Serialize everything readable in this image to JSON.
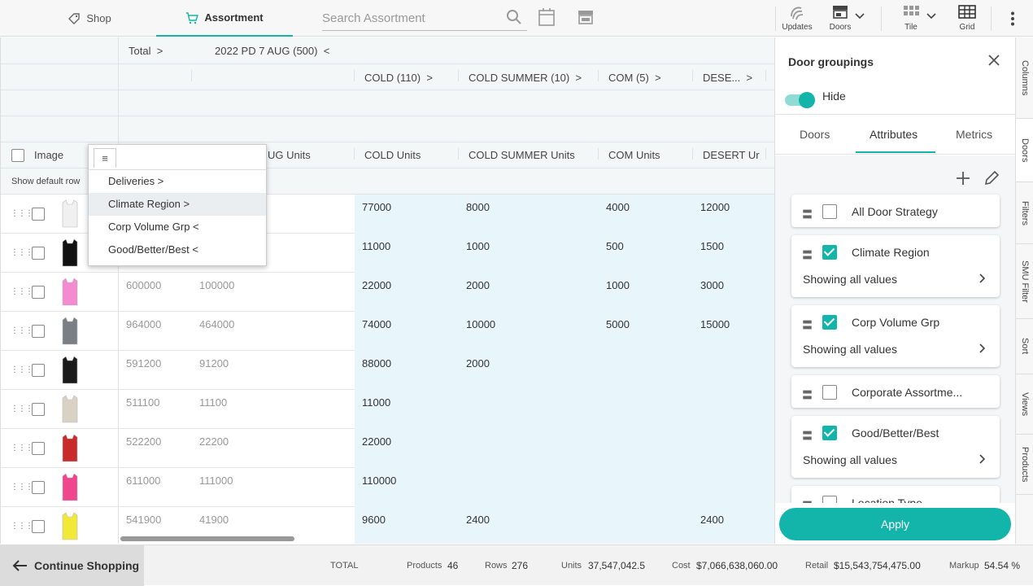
{
  "topbar": {
    "shop_label": "Shop",
    "assortment_label": "Assortment",
    "search_placeholder": "Search Assortment",
    "updates_label": "Updates",
    "doors_label": "Doors",
    "tile_label": "Tile",
    "grid_label": "Grid"
  },
  "grid": {
    "header_row1": {
      "total": "Total",
      "total_chev": ">",
      "period": "2022 PD 7 AUG (500)",
      "period_chev": "<"
    },
    "header_row2": [
      {
        "label": "COLD (110)",
        "chev": ">"
      },
      {
        "label": "COLD SUMMER (10)",
        "chev": ">"
      },
      {
        "label": "COM (5)",
        "chev": ">"
      },
      {
        "label": "DESE...",
        "chev": ">"
      }
    ],
    "columns": {
      "image": "Image",
      "aug_units": "UG Units",
      "cold": "COLD Units",
      "cold_summer": "COLD SUMMER Units",
      "com": "COM Units",
      "desert": "DESERT Ur"
    },
    "show_default_row": "Show default row",
    "rows": [
      {
        "c1": "",
        "c2": "",
        "cold": "77000",
        "cs": "8000",
        "com": "4000",
        "des": "12000",
        "img": "#f0f0f0"
      },
      {
        "c1": "",
        "c2": "",
        "cold": "11000",
        "cs": "1000",
        "com": "500",
        "des": "1500",
        "img": "#111111"
      },
      {
        "c1": "600000",
        "c2": "100000",
        "cold": "22000",
        "cs": "2000",
        "com": "1000",
        "des": "3000",
        "img": "#f48ad0"
      },
      {
        "c1": "964000",
        "c2": "464000",
        "cold": "74000",
        "cs": "10000",
        "com": "5000",
        "des": "15000",
        "img": "#7a7f86"
      },
      {
        "c1": "591200",
        "c2": "91200",
        "cold": "88000",
        "cs": "2000",
        "com": "",
        "des": "",
        "img": "#1a1a1a"
      },
      {
        "c1": "511100",
        "c2": "11100",
        "cold": "11000",
        "cs": "",
        "com": "",
        "des": "",
        "img": "#d9d2c4"
      },
      {
        "c1": "522200",
        "c2": "22200",
        "cold": "22000",
        "cs": "",
        "com": "",
        "des": "",
        "img": "#c92a2a"
      },
      {
        "c1": "611000",
        "c2": "111000",
        "cold": "110000",
        "cs": "",
        "com": "",
        "des": "",
        "img": "#f0468e"
      },
      {
        "c1": "541900",
        "c2": "41900",
        "cold": "9600",
        "cs": "2400",
        "com": "",
        "des": "2400",
        "img": "#f2e838"
      }
    ]
  },
  "popup": {
    "menu_icon": "≡",
    "items": [
      "Deliveries >",
      "Climate Region >",
      "Corp Volume Grp <",
      "Good/Better/Best <"
    ]
  },
  "panel": {
    "title": "Door groupings",
    "toggle_label": "Hide",
    "tabs": [
      "Doors",
      "Attributes",
      "Metrics"
    ],
    "cards": [
      {
        "name": "All Door Strategy",
        "checked": false,
        "sub": ""
      },
      {
        "name": "Climate Region",
        "checked": true,
        "sub": "Showing all values"
      },
      {
        "name": "Corp Volume Grp",
        "checked": true,
        "sub": "Showing all values"
      },
      {
        "name": "Corporate Assortme...",
        "checked": false,
        "sub": ""
      },
      {
        "name": "Good/Better/Best",
        "checked": true,
        "sub": "Showing all values"
      },
      {
        "name": "Location Type",
        "checked": false,
        "sub": ""
      }
    ],
    "apply_label": "Apply"
  },
  "side_tabs": [
    "Columns",
    "Doors",
    "Filters",
    "SMU Filter",
    "Sort",
    "Views",
    "Products"
  ],
  "footer": {
    "continue_label": "Continue Shopping",
    "total_label": "TOTAL",
    "products_label": "Products",
    "products_value": "46",
    "rows_label": "Rows",
    "rows_value": "276",
    "units_label": "Units",
    "units_value": "37,547,042.5",
    "cost_label": "Cost",
    "cost_value": "$7,066,638,060.00",
    "retail_label": "Retail",
    "retail_value": "$15,543,754,475.00",
    "markup_label": "Markup",
    "markup_value": "54.54 %"
  },
  "colors": {
    "accent": "#13b5aa",
    "cell_blue": "#e8f5fb"
  }
}
